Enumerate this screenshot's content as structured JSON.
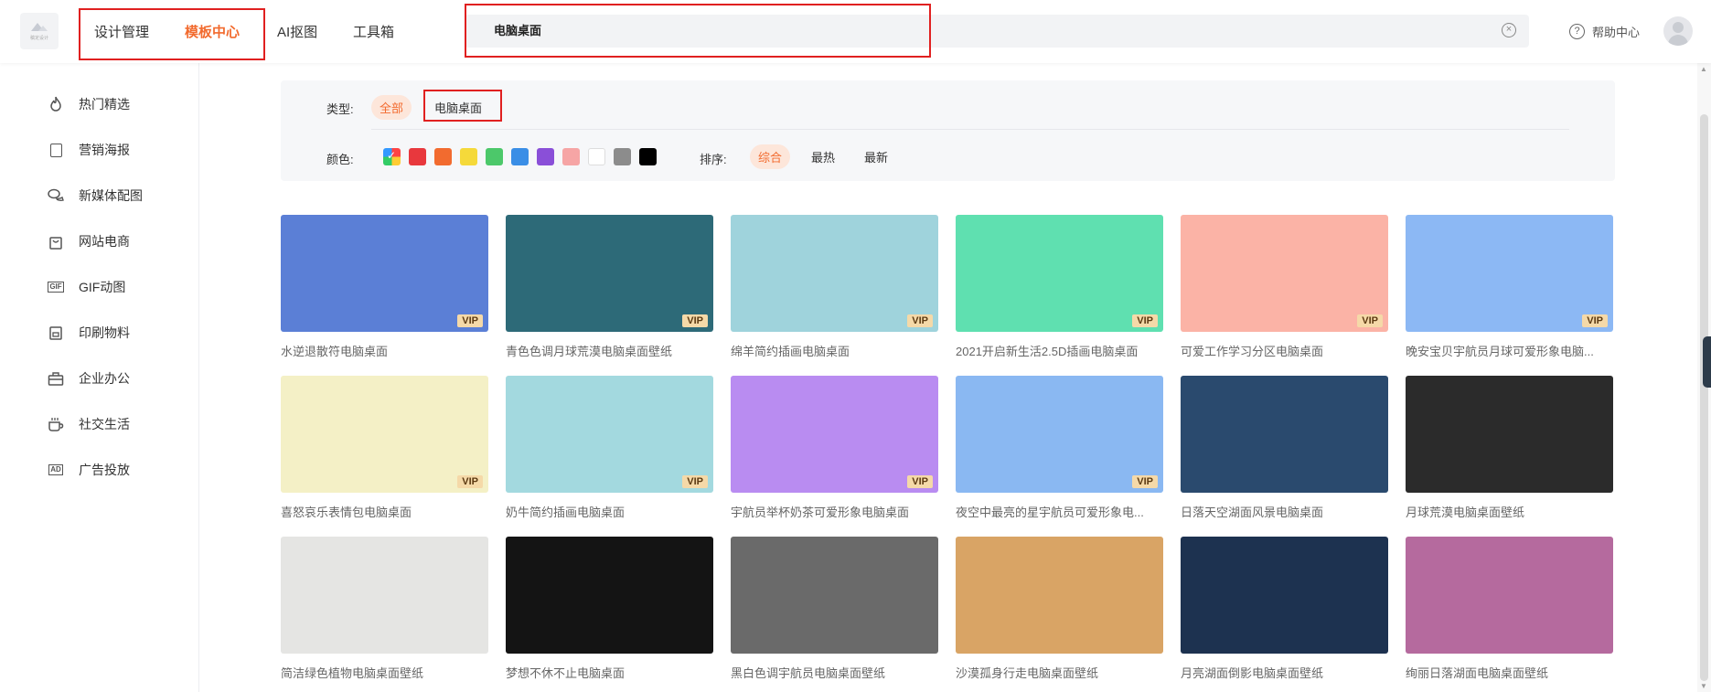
{
  "header": {
    "logo_text": "稿定设计",
    "nav": [
      "设计管理",
      "模板中心",
      "AI抠图",
      "工具箱"
    ],
    "active_nav": "模板中心",
    "search_value": "电脑桌面",
    "help_label": "帮助中心"
  },
  "sidebar": {
    "items": [
      {
        "label": "热门精选",
        "icon": "flame-icon"
      },
      {
        "label": "营销海报",
        "icon": "poster-icon"
      },
      {
        "label": "新媒体配图",
        "icon": "chat-icon"
      },
      {
        "label": "网站电商",
        "icon": "shopping-bag-icon"
      },
      {
        "label": "GIF动图",
        "icon": "gif-icon"
      },
      {
        "label": "印刷物料",
        "icon": "print-icon"
      },
      {
        "label": "企业办公",
        "icon": "briefcase-icon"
      },
      {
        "label": "社交生活",
        "icon": "cup-icon"
      },
      {
        "label": "广告投放",
        "icon": "ad-icon"
      }
    ]
  },
  "filter": {
    "type_label": "类型:",
    "type_options": [
      "全部",
      "电脑桌面"
    ],
    "color_label": "颜色:",
    "colors": [
      "multi",
      "#e8383d",
      "#f26b2f",
      "#f5d93a",
      "#4cc86a",
      "#3a8ee6",
      "#8a4fd8",
      "#f6a5a5",
      "#ffffff",
      "#8c8c8c",
      "#000000"
    ],
    "sort_label": "排序:",
    "sort_options": [
      "综合",
      "最热",
      "最新"
    ],
    "sort_active": "综合"
  },
  "templates": [
    {
      "title": "水逆退散符电脑桌面",
      "vip": "VIP",
      "bg": "#5b7fd6"
    },
    {
      "title": "青色色调月球荒漠电脑桌面壁纸",
      "vip": "VIP",
      "bg": "#2d6a78"
    },
    {
      "title": "绵羊简约插画电脑桌面",
      "vip": "VIP",
      "bg": "#9fd3dc"
    },
    {
      "title": "2021开启新生活2.5D插画电脑桌面",
      "vip": "VIP",
      "bg": "#5fe0b0"
    },
    {
      "title": "可爱工作学习分区电脑桌面",
      "vip": "VIP",
      "bg": "#fbb3a6"
    },
    {
      "title": "晚安宝贝宇航员月球可爱形象电脑...",
      "vip": "VIP",
      "bg": "#8cb8f4"
    },
    {
      "title": "喜怒哀乐表情包电脑桌面",
      "vip": "VIP",
      "bg": "#f4f0c6"
    },
    {
      "title": "奶牛简约插画电脑桌面",
      "vip": "VIP",
      "bg": "#a3d9df"
    },
    {
      "title": "宇航员举杯奶茶可爱形象电脑桌面",
      "vip": "VIP",
      "bg": "#b98cf1"
    },
    {
      "title": "夜空中最亮的星宇航员可爱形象电...",
      "vip": "VIP",
      "bg": "#8ab8f2"
    },
    {
      "title": "日落天空湖面风景电脑桌面",
      "vip": "",
      "bg": "#2a4a6e"
    },
    {
      "title": "月球荒漠电脑桌面壁纸",
      "vip": "",
      "bg": "#2b2b2b"
    },
    {
      "title": "简洁绿色植物电脑桌面壁纸",
      "vip": "",
      "bg": "#e5e5e3"
    },
    {
      "title": "梦想不休不止电脑桌面",
      "vip": "",
      "bg": "#141414"
    },
    {
      "title": "黑白色调宇航员电脑桌面壁纸",
      "vip": "",
      "bg": "#6a6a6a"
    },
    {
      "title": "沙漠孤身行走电脑桌面壁纸",
      "vip": "",
      "bg": "#d9a465"
    },
    {
      "title": "月亮湖面倒影电脑桌面壁纸",
      "vip": "",
      "bg": "#1d3250"
    },
    {
      "title": "绚丽日落湖面电脑桌面壁纸",
      "vip": "",
      "bg": "#b56a9e"
    }
  ]
}
